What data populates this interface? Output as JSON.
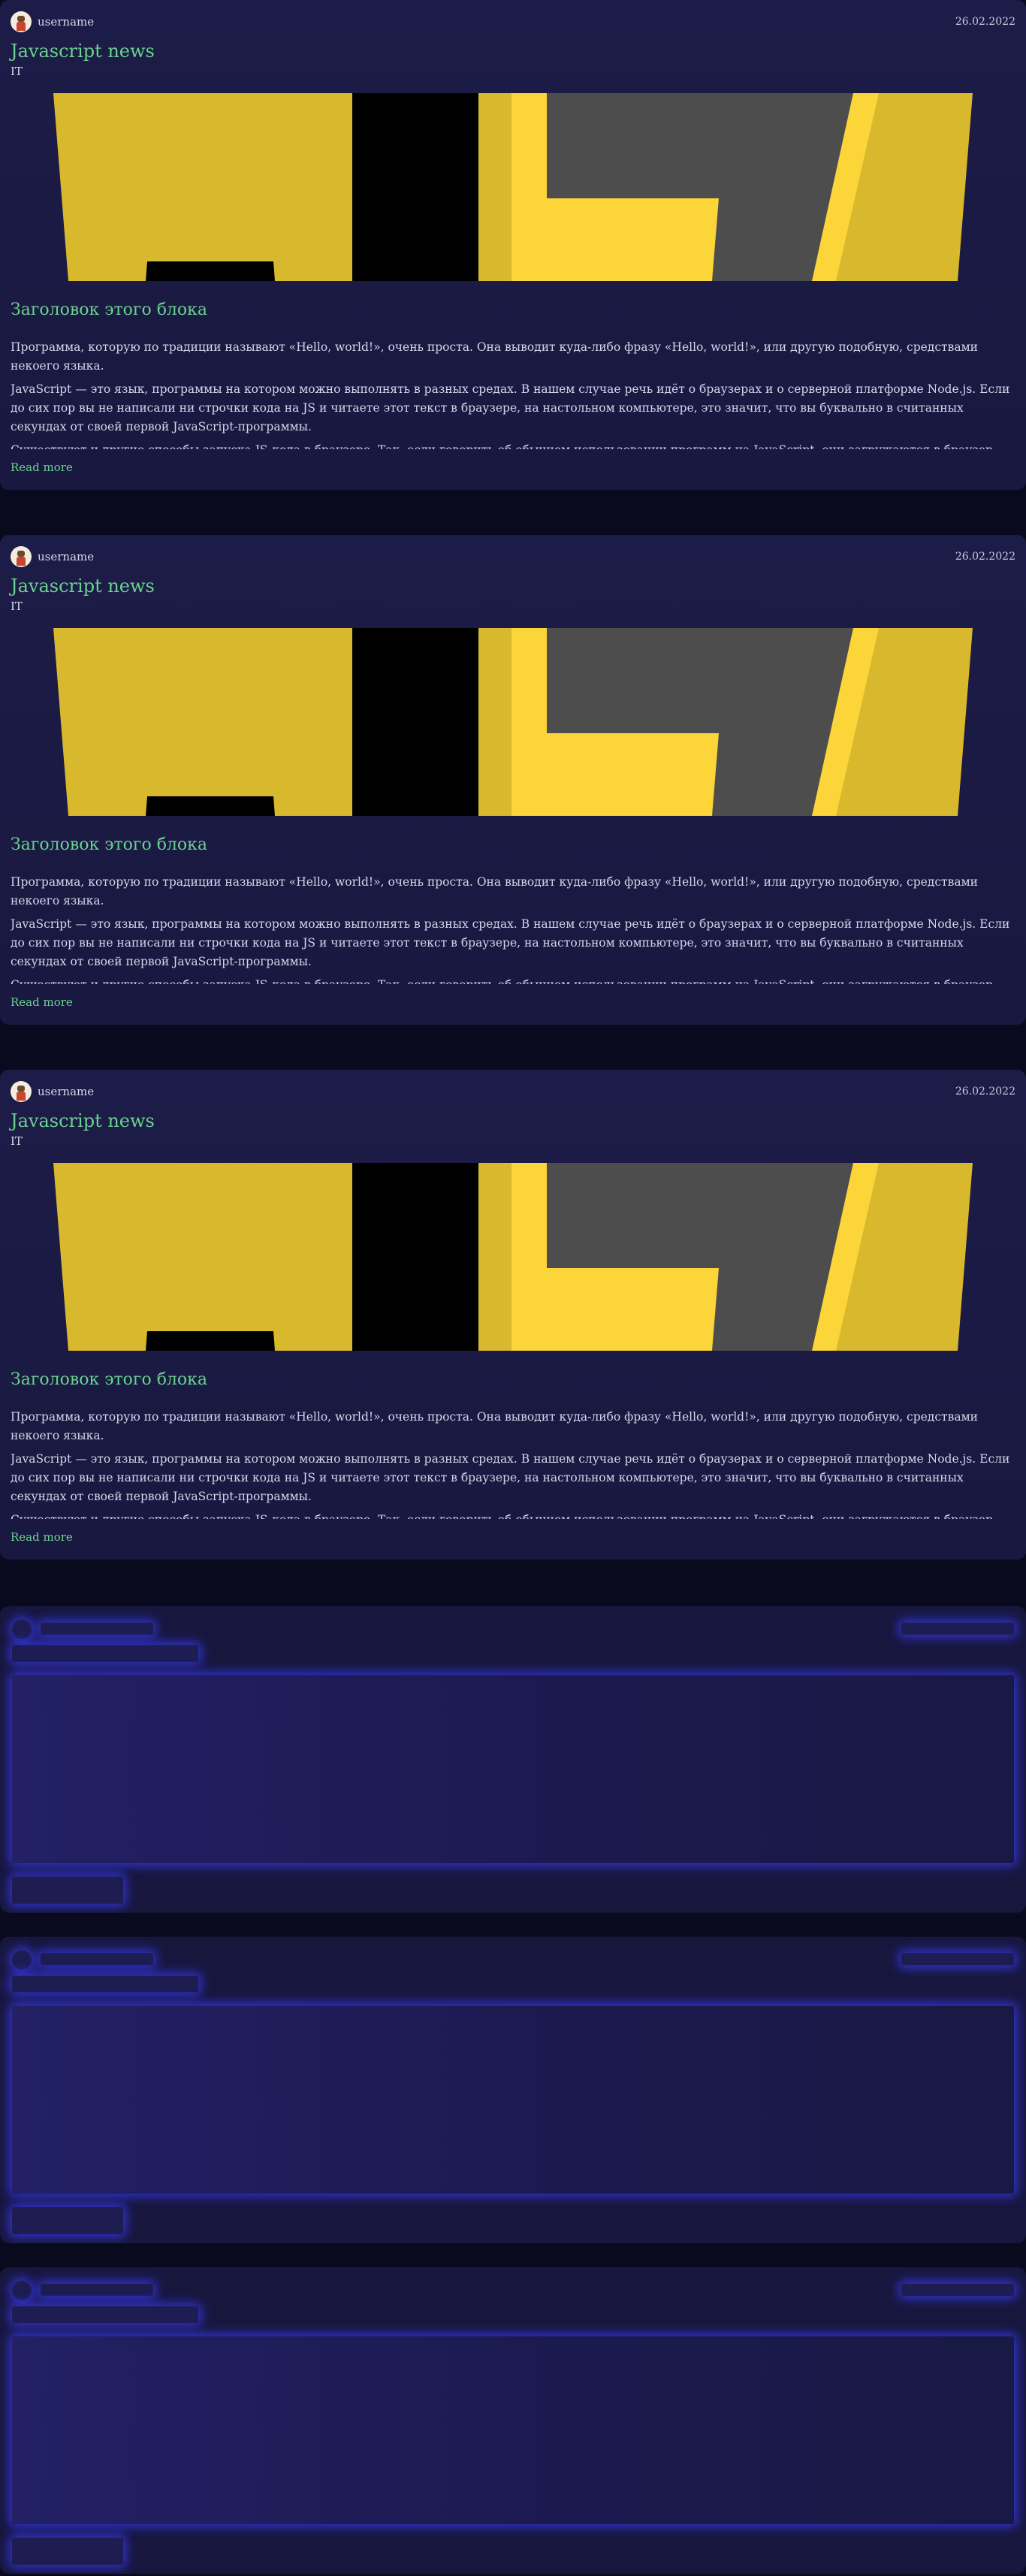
{
  "posts": [
    {
      "username": "username",
      "date": "26.02.2022",
      "title": "Javascript news",
      "category": "IT",
      "block_title": "Заголовок этого блока",
      "paragraphs": [
        "Программа, которую по традиции называют «Hello, world!», очень проста. Она выводит куда-либо фразу «Hello, world!», или другую подобную, средствами некоего языка.",
        "JavaScript — это язык, программы на котором можно выполнять в разных средах. В нашем случае речь идёт о браузерах и о серверной платформе Node.js. Если до сих пор вы не написали ни строчки кода на JS и читаете этот текст в браузере, на настольном компьютере, это значит, что вы буквально в считанных секундах от своей первой JavaScript-программы.",
        "Существуют и другие способы запуска JS-кода в браузере. Так, если говорить об обычном использовании программ на JavaScript, они загружаются в браузер для обеспечения работы веб-страниц. Как правило, код оформляют в виде отдельных файлов с расширением .js, которые подключают к веб-страницам, но программный код можно включать и непосредственно в код страницы. Всё это делается с помощью тега <script>. Когда браузер обнаруживает такой код, он выполняет его. Подробности о теге script можно посмотреть на сайте w3school.com. В частности, рассмотрим"
      ],
      "read_more": "Read more"
    },
    {
      "username": "username",
      "date": "26.02.2022",
      "title": "Javascript news",
      "category": "IT",
      "block_title": "Заголовок этого блока",
      "paragraphs": [
        "Программа, которую по традиции называют «Hello, world!», очень проста. Она выводит куда-либо фразу «Hello, world!», или другую подобную, средствами некоего языка.",
        "JavaScript — это язык, программы на котором можно выполнять в разных средах. В нашем случае речь идёт о браузерах и о серверной платформе Node.js. Если до сих пор вы не написали ни строчки кода на JS и читаете этот текст в браузере, на настольном компьютере, это значит, что вы буквально в считанных секундах от своей первой JavaScript-программы.",
        "Существуют и другие способы запуска JS-кода в браузере. Так, если говорить об обычном использовании программ на JavaScript, они загружаются в браузер для обеспечения работы веб-страниц. Как правило, код оформляют в виде отдельных файлов с расширением .js, которые подключают к веб-страницам, но программный код можно включать и непосредственно в код страницы. Всё это делается с помощью тега <script>. Когда браузер обнаруживает такой код, он выполняет его. Подробности о теге script можно посмотреть на сайте w3school.com. В частности, рассмотрим"
      ],
      "read_more": "Read more"
    },
    {
      "username": "username",
      "date": "26.02.2022",
      "title": "Javascript news",
      "category": "IT",
      "block_title": "Заголовок этого блока",
      "paragraphs": [
        "Программа, которую по традиции называют «Hello, world!», очень проста. Она выводит куда-либо фразу «Hello, world!», или другую подобную, средствами некоего языка.",
        "JavaScript — это язык, программы на котором можно выполнять в разных средах. В нашем случае речь идёт о браузерах и о серверной платформе Node.js. Если до сих пор вы не написали ни строчки кода на JS и читаете этот текст в браузере, на настольном компьютере, это значит, что вы буквально в считанных секундах от своей первой JavaScript-программы.",
        "Существуют и другие способы запуска JS-кода в браузере. Так, если говорить об обычном использовании программ на JavaScript, они загружаются в браузер для обеспечения работы веб-страниц. Как правило, код оформляют в виде отдельных файлов с расширением .js, которые подключают к веб-страницам, но программный код можно включать и непосредственно в код страницы. Всё это делается с помощью тега <script>. Когда браузер обнаруживает такой код, он выполняет его. Подробности о теге script можно посмотреть на сайте w3school.com. В частности, рассмотрим"
      ],
      "read_more": "Read more"
    }
  ],
  "skeleton_count": 3,
  "colors": {
    "background": "#0a0a1e",
    "card": "#1c1c48",
    "accent_green": "#6bd28f",
    "js_yellow": "#d8b92e",
    "js_bright_yellow": "#fcd538",
    "js_gray": "#4d4d4d",
    "skeleton_glow": "#3c3cff"
  },
  "icons": {
    "avatar": "user-avatar-icon",
    "post_image": "javascript-logo-image"
  }
}
